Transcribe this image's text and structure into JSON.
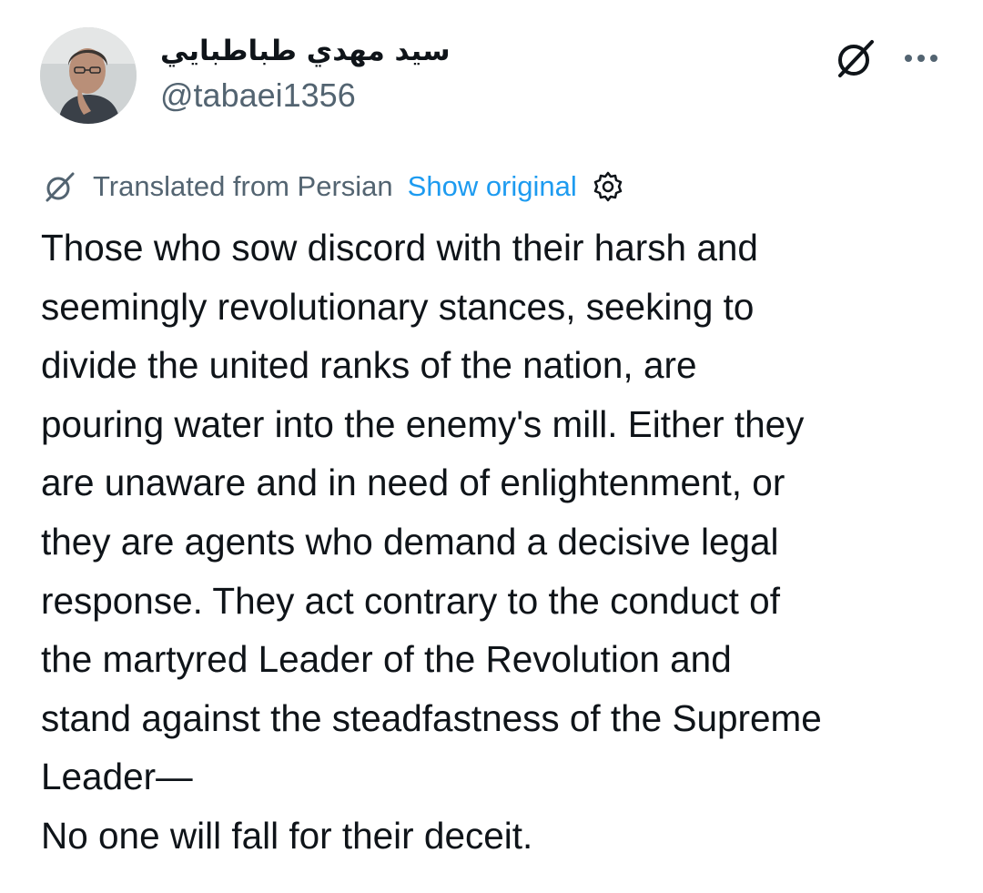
{
  "author": {
    "display_name": "سيد مهدي طباطبايي",
    "handle": "@tabaei1356"
  },
  "actions": {
    "grok_icon": "grok-icon",
    "more_icon": "more-options-icon",
    "more_label": "···"
  },
  "translation": {
    "notice": "Translated from Persian",
    "show_original": "Show original",
    "translate_icon": "grok-translate-icon",
    "settings_icon": "gear-icon"
  },
  "post": {
    "text": "Those who sow discord with their harsh and\nseemingly revolutionary stances, seeking to\ndivide the united ranks of the nation, are\npouring water into the enemy's mill. Either they\nare unaware and in need of enlightenment, or\nthey are agents who demand a decisive legal\nresponse. They act contrary to the conduct of\nthe martyred Leader of the Revolution and\nstand against the steadfastness of the Supreme\nLeader—\nNo one will fall for their deceit."
  },
  "colors": {
    "text_primary": "#0f1419",
    "text_secondary": "#536471",
    "link": "#1d9bf0"
  }
}
